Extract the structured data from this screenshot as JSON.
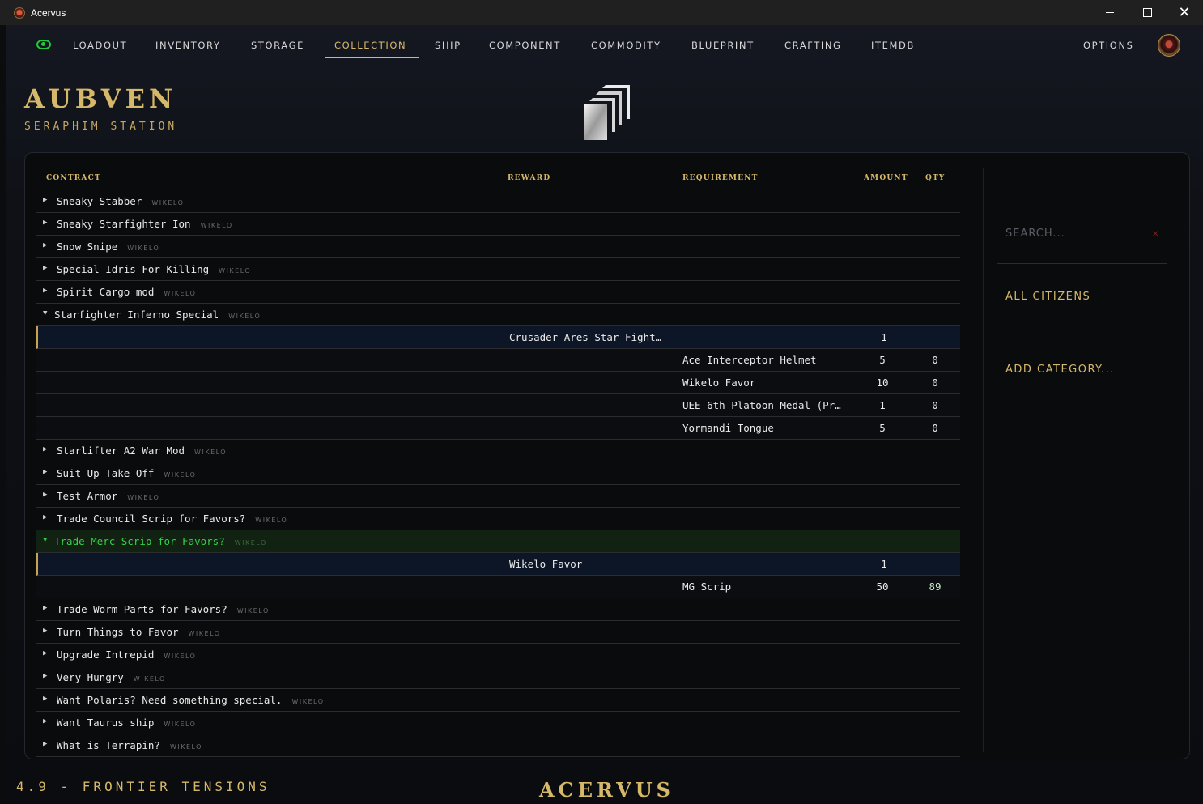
{
  "window": {
    "title": "Acervus",
    "minimize": "—",
    "maximize": "☐",
    "close": "✕"
  },
  "nav": {
    "tabs": [
      "LOADOUT",
      "INVENTORY",
      "STORAGE",
      "COLLECTION",
      "SHIP",
      "COMPONENT",
      "COMMODITY",
      "BLUEPRINT",
      "CRAFTING",
      "ITEMDB"
    ],
    "active": "COLLECTION",
    "options": "OPTIONS"
  },
  "location": {
    "title": "AUBVEN",
    "subtitle": "SERAPHIM STATION"
  },
  "table": {
    "headers": {
      "contract": "CONTRACT",
      "reward": "REWARD",
      "requirement": "REQUIREMENT",
      "amount": "AMOUNT",
      "qty": "QTY"
    },
    "rows": [
      {
        "type": "contract",
        "name": "Sneaky Stabber",
        "tag": "WIKELO",
        "arrow": "▶"
      },
      {
        "type": "contract",
        "name": "Sneaky Starfighter Ion",
        "tag": "WIKELO",
        "arrow": "▶"
      },
      {
        "type": "contract",
        "name": "Snow Snipe",
        "tag": "WIKELO",
        "arrow": "▶"
      },
      {
        "type": "contract",
        "name": "Special Idris For Killing",
        "tag": "WIKELO",
        "arrow": "▶"
      },
      {
        "type": "contract",
        "name": "Spirit Cargo mod",
        "tag": "WIKELO",
        "arrow": "▶"
      },
      {
        "type": "contract-open",
        "name": "Starfighter Inferno Special",
        "tag": "WIKELO",
        "arrow": "▼"
      },
      {
        "type": "reward",
        "reward": "Crusader Ares Star Fight…",
        "amount": "1"
      },
      {
        "type": "req",
        "requirement": "Ace Interceptor Helmet",
        "amount": "5",
        "qty": "0"
      },
      {
        "type": "req",
        "requirement": "Wikelo Favor",
        "amount": "10",
        "qty": "0"
      },
      {
        "type": "req",
        "requirement": "UEE 6th Platoon Medal (Pr…",
        "amount": "1",
        "qty": "0"
      },
      {
        "type": "req",
        "requirement": "Yormandi Tongue",
        "amount": "5",
        "qty": "0"
      },
      {
        "type": "contract",
        "name": "Starlifter A2 War Mod",
        "tag": "WIKELO",
        "arrow": "▶"
      },
      {
        "type": "contract",
        "name": "Suit Up Take Off",
        "tag": "WIKELO",
        "arrow": "▶"
      },
      {
        "type": "contract",
        "name": "Test Armor",
        "tag": "WIKELO",
        "arrow": "▶"
      },
      {
        "type": "contract",
        "name": "Trade Council Scrip for Favors?",
        "tag": "WIKELO",
        "arrow": "▶"
      },
      {
        "type": "contract-hl",
        "name": "Trade Merc Scrip for Favors?",
        "tag": "WIKELO",
        "arrow": "▼"
      },
      {
        "type": "reward",
        "reward": "Wikelo Favor",
        "amount": "1"
      },
      {
        "type": "req-good",
        "requirement": "MG Scrip",
        "amount": "50",
        "qty": "89"
      },
      {
        "type": "contract",
        "name": "Trade Worm Parts for Favors?",
        "tag": "WIKELO",
        "arrow": "▶"
      },
      {
        "type": "contract",
        "name": "Turn Things to Favor",
        "tag": "WIKELO",
        "arrow": "▶"
      },
      {
        "type": "contract",
        "name": "Upgrade Intrepid",
        "tag": "WIKELO",
        "arrow": "▶"
      },
      {
        "type": "contract",
        "name": "Very Hungry",
        "tag": "WIKELO",
        "arrow": "▶"
      },
      {
        "type": "contract",
        "name": "Want Polaris? Need something special.",
        "tag": "WIKELO",
        "arrow": "▶"
      },
      {
        "type": "contract",
        "name": "Want Taurus ship",
        "tag": "WIKELO",
        "arrow": "▶"
      },
      {
        "type": "contract",
        "name": "What is Terrapin?",
        "tag": "WIKELO",
        "arrow": "▶"
      }
    ]
  },
  "sidebar": {
    "search_placeholder": "SEARCH...",
    "clear": "✕",
    "all_citizens": "ALL CITIZENS",
    "add_category": "ADD CATEGORY..."
  },
  "footer": {
    "version": "4.9 - FRONTIER TENSIONS",
    "brand": "ACERVUS"
  },
  "colors": {
    "accent": "#d6b86a",
    "active_green": "#33d14a",
    "bg": "#0b0c0e"
  }
}
